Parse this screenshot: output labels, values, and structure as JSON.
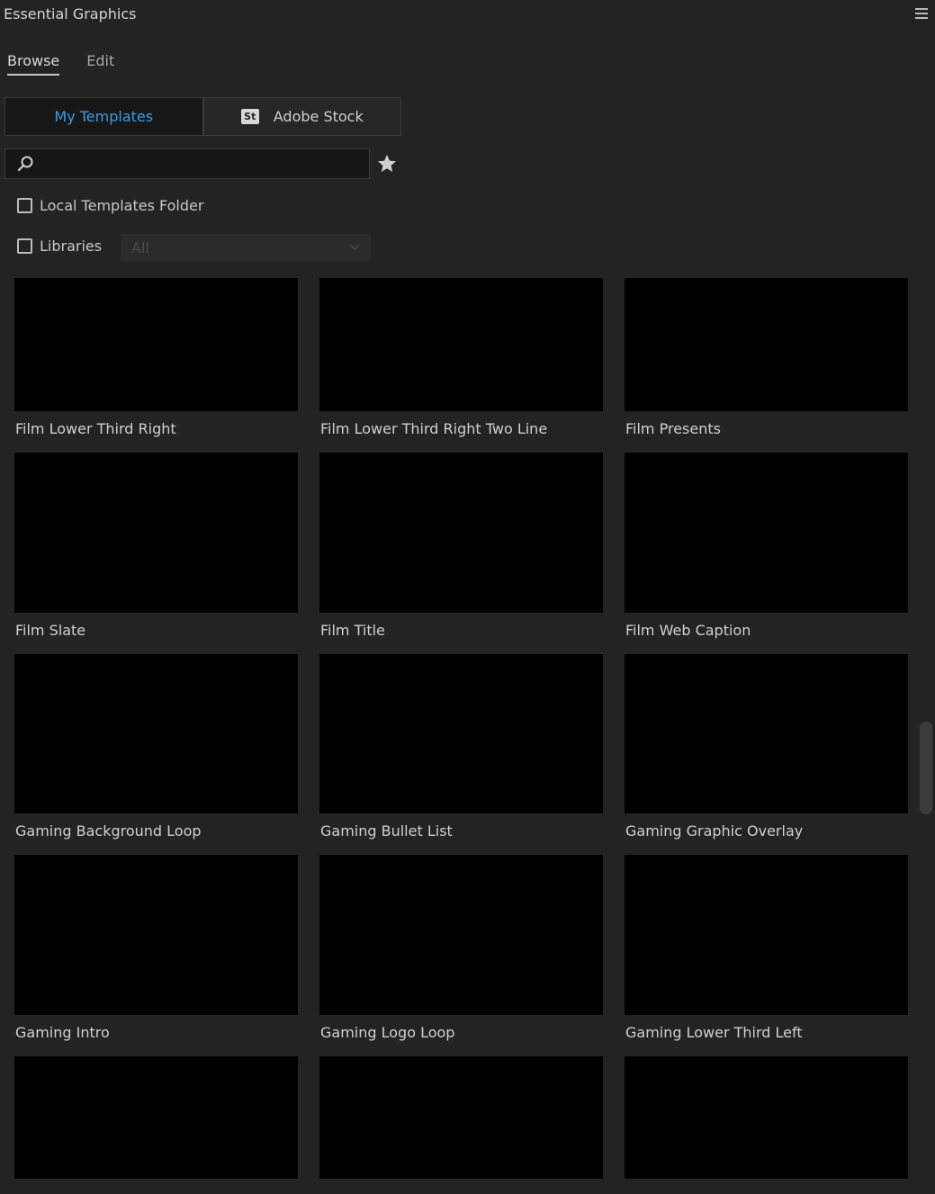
{
  "panel": {
    "title": "Essential Graphics"
  },
  "tabs": [
    {
      "label": "Browse",
      "active": true
    },
    {
      "label": "Edit",
      "active": false
    }
  ],
  "sources": {
    "my_templates": "My Templates",
    "adobe_stock": "Adobe Stock",
    "stock_badge": "St"
  },
  "search": {
    "value": "",
    "placeholder": ""
  },
  "filters": {
    "local_templates": {
      "label": "Local Templates Folder",
      "checked": false
    },
    "libraries": {
      "label": "Libraries",
      "checked": false,
      "selected": "All"
    }
  },
  "templates": [
    {
      "label": "Film Lower Third Right"
    },
    {
      "label": "Film Lower Third Right Two Line"
    },
    {
      "label": "Film Presents"
    },
    {
      "label": "Film Slate"
    },
    {
      "label": "Film Title"
    },
    {
      "label": "Film Web Caption"
    },
    {
      "label": "Gaming Background Loop"
    },
    {
      "label": "Gaming Bullet List"
    },
    {
      "label": "Gaming Graphic Overlay"
    },
    {
      "label": "Gaming Intro"
    },
    {
      "label": "Gaming Logo Loop"
    },
    {
      "label": "Gaming Lower Third Left"
    },
    {
      "label": ""
    },
    {
      "label": ""
    },
    {
      "label": ""
    }
  ],
  "colors": {
    "panel_bg": "#232323",
    "accent": "#3d9be3",
    "thumbnail": "#000000"
  },
  "icons": {
    "menu": "hamburger-menu-icon",
    "search": "search-icon",
    "favorite": "star-icon",
    "dropdown": "chevron-down-icon"
  }
}
